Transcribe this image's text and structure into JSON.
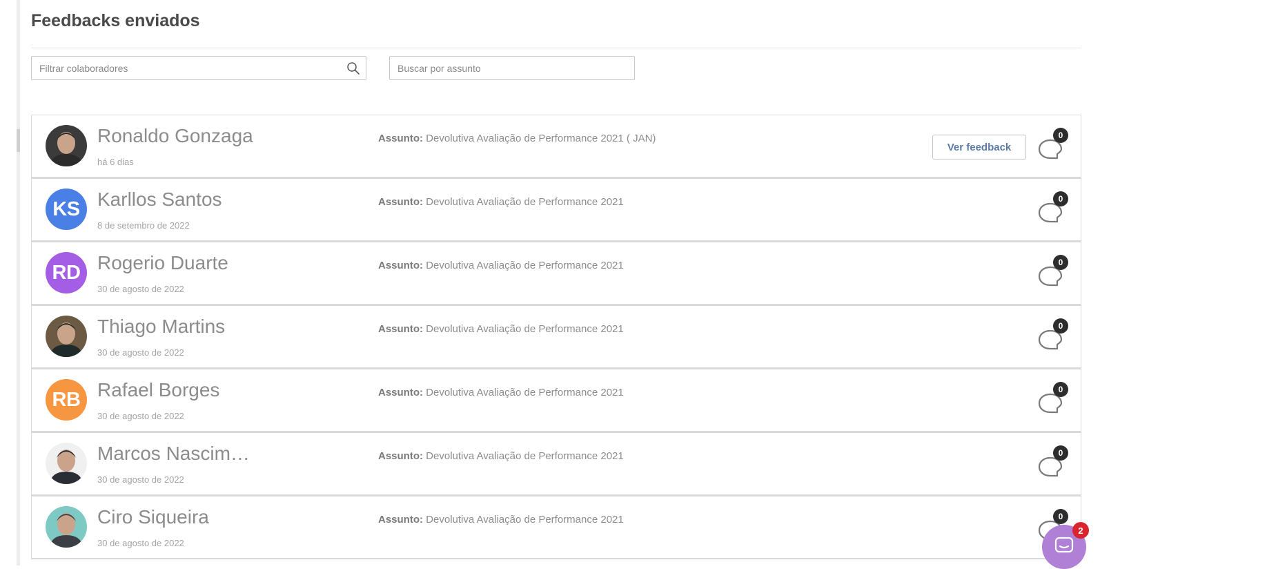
{
  "page": {
    "title": "Feedbacks enviados"
  },
  "filters": {
    "collaborators_placeholder": "Filtrar colaboradores",
    "subject_placeholder": "Buscar por assunto",
    "search_icon": "search-icon"
  },
  "subject_label": "Assunto:",
  "view_button_label": "Ver feedback",
  "feedbacks": [
    {
      "name": "Ronaldo Gonzaga",
      "date": "há 6 dias",
      "subject": "Devolutiva Avaliação de Performance 2021 ( JAN)",
      "comments": "0",
      "avatar": {
        "type": "photo"
      },
      "show_button": true
    },
    {
      "name": "Karllos Santos",
      "date": "8 de setembro de 2022",
      "subject": "Devolutiva Avaliação de Performance 2021",
      "comments": "0",
      "avatar": {
        "type": "initials",
        "initials": "KS",
        "color": "#4a7fe6"
      },
      "show_button": false
    },
    {
      "name": "Rogerio Duarte",
      "date": "30 de agosto de 2022",
      "subject": "Devolutiva Avaliação de Performance 2021",
      "comments": "0",
      "avatar": {
        "type": "initials",
        "initials": "RD",
        "color": "#a45ee5"
      },
      "show_button": false
    },
    {
      "name": "Thiago Martins",
      "date": "30 de agosto de 2022",
      "subject": "Devolutiva Avaliação de Performance 2021",
      "comments": "0",
      "avatar": {
        "type": "photo"
      },
      "show_button": false
    },
    {
      "name": "Rafael Borges",
      "date": "30 de agosto de 2022",
      "subject": "Devolutiva Avaliação de Performance 2021",
      "comments": "0",
      "avatar": {
        "type": "initials",
        "initials": "RB",
        "color": "#f79640"
      },
      "show_button": false
    },
    {
      "name": "Marcos Nascimento",
      "date": "30 de agosto de 2022",
      "subject": "Devolutiva Avaliação de Performance 2021",
      "comments": "0",
      "avatar": {
        "type": "photo"
      },
      "show_button": false
    },
    {
      "name": "Ciro Siqueira",
      "date": "30 de agosto de 2022",
      "subject": "Devolutiva Avaliação de Performance 2021",
      "comments": "0",
      "avatar": {
        "type": "photo"
      },
      "show_button": false
    }
  ],
  "chat_widget": {
    "unread": "2",
    "icon": "chat-icon"
  }
}
